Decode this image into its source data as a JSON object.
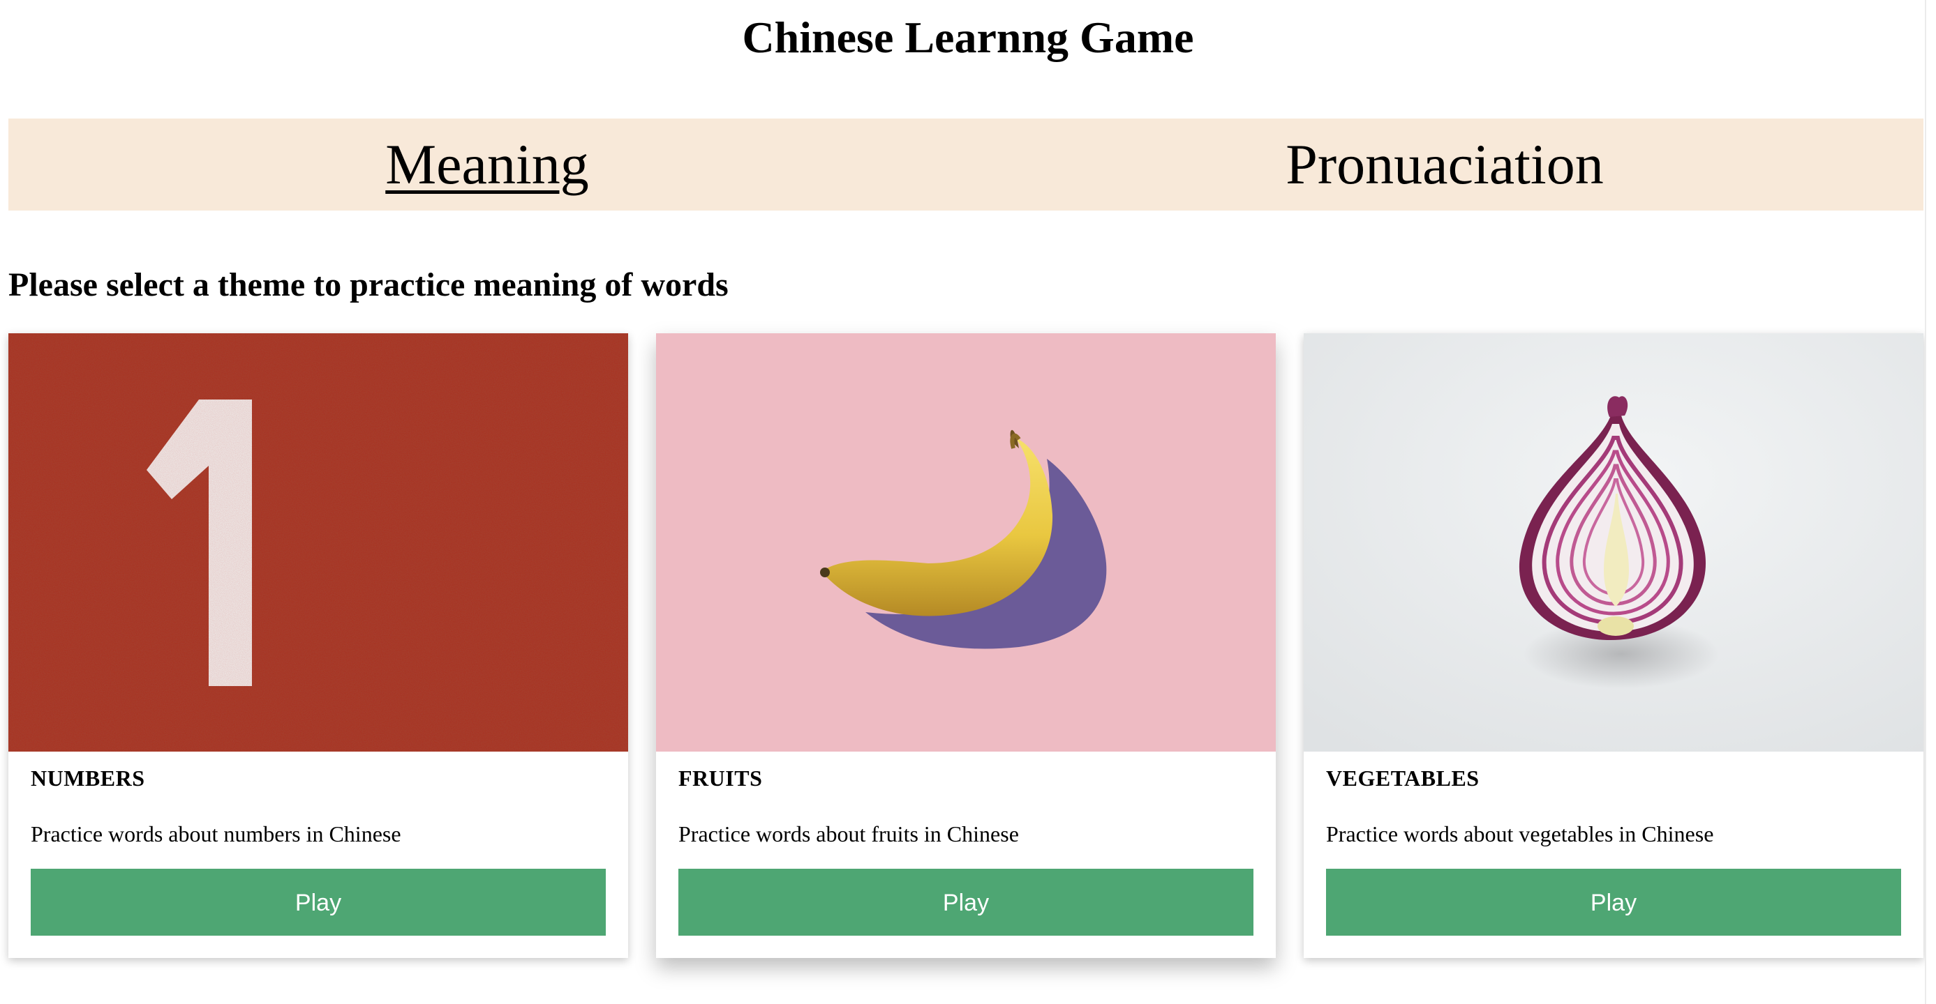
{
  "header": {
    "title": "Chinese Learnng Game"
  },
  "nav": {
    "items": [
      {
        "label": "Meaning",
        "active": true
      },
      {
        "label": "Pronuaciation",
        "active": false
      }
    ]
  },
  "main": {
    "subtitle": "Please select a theme to practice meaning of words",
    "cards": [
      {
        "title": "NUMBERS",
        "description": "Practice words about numbers in Chinese",
        "button_label": "Play",
        "image": "number-one-on-running-track"
      },
      {
        "title": "FRUITS",
        "description": "Practice words about fruits in Chinese",
        "button_label": "Play",
        "image": "banana-on-pink-background"
      },
      {
        "title": "VEGETABLES",
        "description": "Practice words about vegetables in Chinese",
        "button_label": "Play",
        "image": "halved-red-onion"
      }
    ]
  },
  "colors": {
    "nav_background": "#f8e9d9",
    "button_background": "#4ea673",
    "button_text": "#ffffff",
    "track_red": "#a8301f",
    "banana_pink": "#eebbc3",
    "onion_background": "#e6e9ea"
  }
}
